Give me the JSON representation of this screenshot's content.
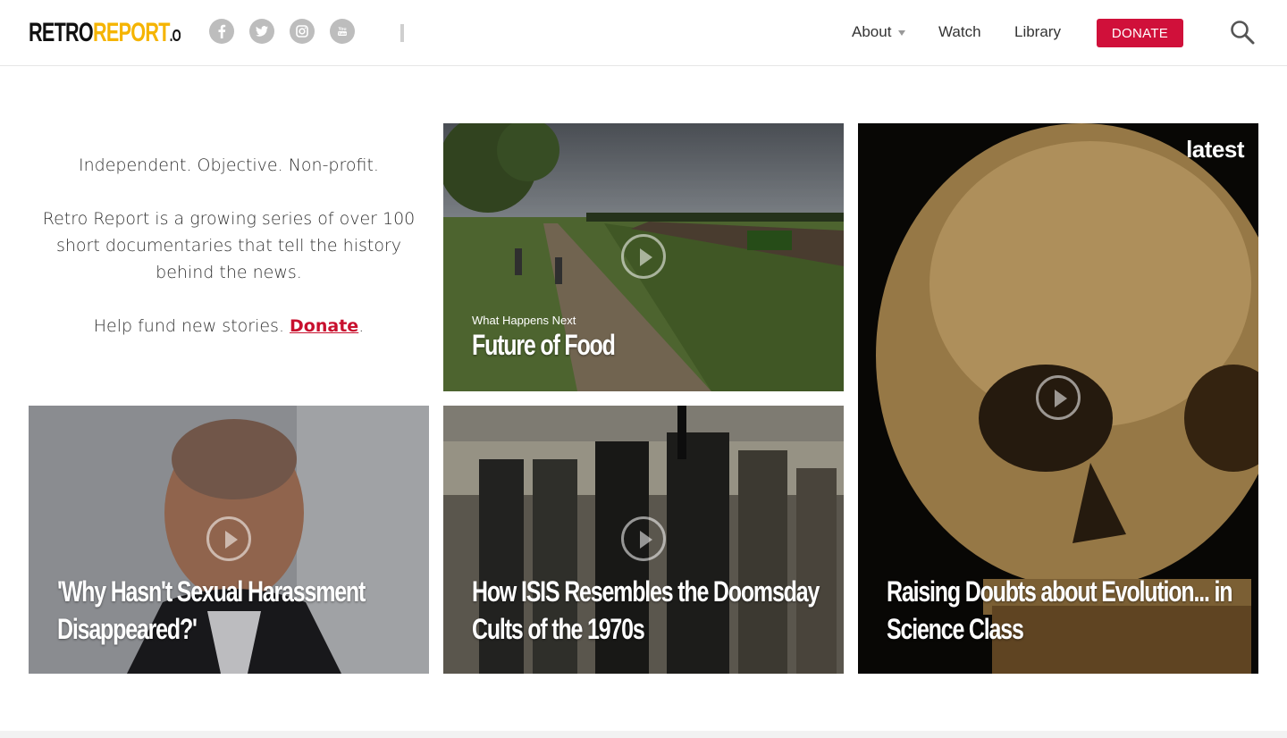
{
  "header": {
    "logo": {
      "retro": "RETRO",
      "report": "REPORT",
      "org": ".ORG"
    },
    "social": [
      {
        "name": "facebook",
        "glyph": "f"
      },
      {
        "name": "twitter",
        "glyph": "t"
      },
      {
        "name": "instagram",
        "glyph": "ig"
      },
      {
        "name": "youtube",
        "glyph": "You"
      }
    ],
    "nav": {
      "about": "About",
      "watch": "Watch",
      "library": "Library"
    },
    "donate_label": "DONATE"
  },
  "intro": {
    "tagline": "Independent. Objective. Non-profit.",
    "body": "Retro Report is a growing series of over 100 short documentaries that tell the history behind the news.",
    "help_prefix": "Help fund new stories. ",
    "donate_link": "Donate",
    "help_suffix": "."
  },
  "tiles": {
    "food": {
      "kicker": "What Happens Next",
      "title": "Future of Food"
    },
    "harassment": {
      "title": "'Why Hasn't Sexual Harassment Disappeared?'"
    },
    "isis": {
      "title": "How ISIS Resembles the Doomsday Cults of the 1970s"
    },
    "evolution": {
      "badge": "latest",
      "title": "Raising Doubts about Evolution... in Science Class"
    }
  },
  "colors": {
    "accent": "#d0103a",
    "logo_yellow": "#f5b400"
  }
}
